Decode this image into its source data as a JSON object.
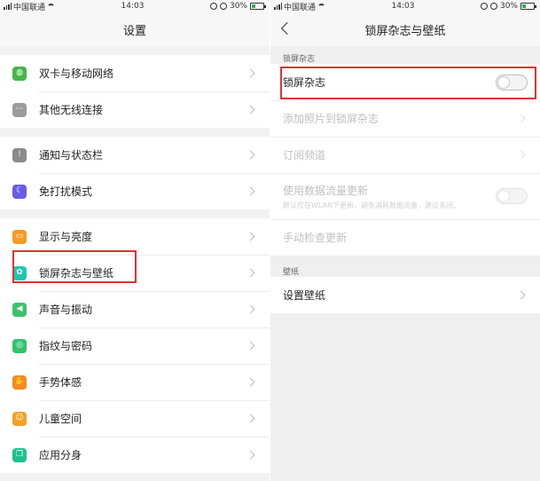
{
  "left": {
    "status": {
      "carrier": "中国联通",
      "time": "14:03",
      "battery": "30%",
      "battery_level": 0.3
    },
    "title": "设置",
    "groups": [
      [
        {
          "label": "双卡与移动网络",
          "icon": "globe-icon",
          "color": "#43b649"
        },
        {
          "label": "其他无线连接",
          "icon": "more-icon",
          "color": "#9b9b9b"
        }
      ],
      [
        {
          "label": "通知与状态栏",
          "icon": "notice-icon",
          "color": "#8a8a8a"
        },
        {
          "label": "免打扰模式",
          "icon": "moon-icon",
          "color": "#6a5be6"
        }
      ],
      [
        {
          "label": "显示与亮度",
          "icon": "display-icon",
          "color": "#f59a23"
        },
        {
          "label": "锁屏杂志与壁纸",
          "icon": "flower-icon",
          "color": "#1fc6b0"
        },
        {
          "label": "声音与振动",
          "icon": "speaker-icon",
          "color": "#3cc36a"
        },
        {
          "label": "指纹与密码",
          "icon": "fingerprint-icon",
          "color": "#33c36b"
        },
        {
          "label": "手势体感",
          "icon": "hand-icon",
          "color": "#f78a1f"
        },
        {
          "label": "儿童空间",
          "icon": "child-icon",
          "color": "#f5a027"
        },
        {
          "label": "应用分身",
          "icon": "clone-icon",
          "color": "#20c08d"
        }
      ]
    ]
  },
  "right": {
    "status": {
      "carrier": "中国联通",
      "time": "14:03",
      "battery": "30%",
      "battery_level": 0.3
    },
    "title": "锁屏杂志与壁纸",
    "section1": "锁屏杂志",
    "magazine_toggle": "锁屏杂志",
    "add_photos": "添加照片到锁屏杂志",
    "subscribe": "订阅频道",
    "mobile_data": "使用数据流量更新",
    "mobile_data_sub": "默认仅在WLAN下更新，避免消耗数据流量，建议关闭。",
    "manual_update": "手动检查更新",
    "section2": "壁纸",
    "set_wallpaper": "设置壁纸"
  }
}
